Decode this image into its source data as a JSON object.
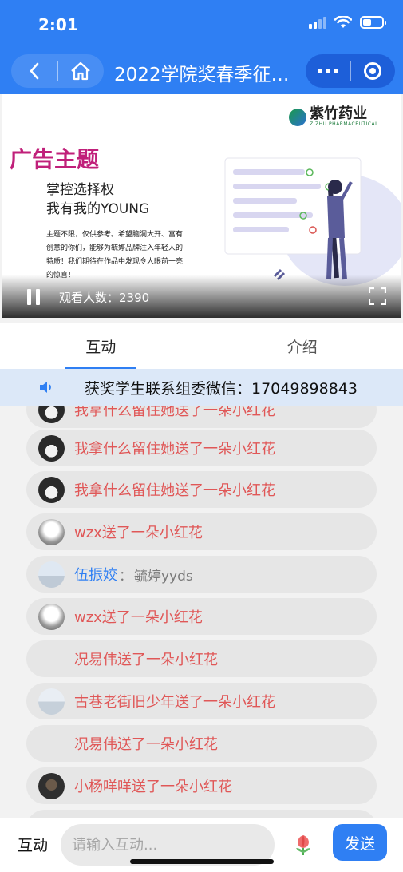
{
  "status": {
    "time": "2:01"
  },
  "nav": {
    "title": "2022学院奖春季征…"
  },
  "video": {
    "brand_name": "紫竹药业",
    "brand_sub": "ZIZHU PHARMACEUTICAL",
    "ad_title": "广告主题",
    "slogan_line1": "掌控选择权",
    "slogan_line2": "我有我的YOUNG",
    "body": "主题不限，仅供参考。希望脑洞大开、富有创意的你们，能够为毓婷品牌注入年轻人的特质！我们期待在作品中发现令人眼前一亮的惊喜！",
    "viewers": "观看人数：2390"
  },
  "tabs": [
    "互动",
    "介绍"
  ],
  "notice": {
    "text": "获奖学生联系组委微信：17049898843"
  },
  "messages": [
    {
      "text": "我拿什么留住她送了一朵小红花"
    },
    {
      "text": "我拿什么留住她送了一朵小红花"
    },
    {
      "text": "我拿什么留住她送了一朵小红花"
    },
    {
      "text": "wzx送了一朵小红花"
    },
    {
      "name": "伍振姣",
      "sep": "：",
      "comment": "毓婷yyds"
    },
    {
      "text": "wzx送了一朵小红花"
    },
    {
      "text": "况易伟送了一朵小红花"
    },
    {
      "text": "古巷老街旧少年送了一朵小红花"
    },
    {
      "text": "况易伟送了一朵小红花"
    },
    {
      "text": "小杨咩咩送了一朵小红花"
    }
  ],
  "bottom": {
    "label": "互动",
    "placeholder": "请输入互动...",
    "send": "发送"
  },
  "colors": {
    "accent": "#2f7ff3",
    "gift_text": "#e05757",
    "name_text": "#2f7ff3"
  }
}
